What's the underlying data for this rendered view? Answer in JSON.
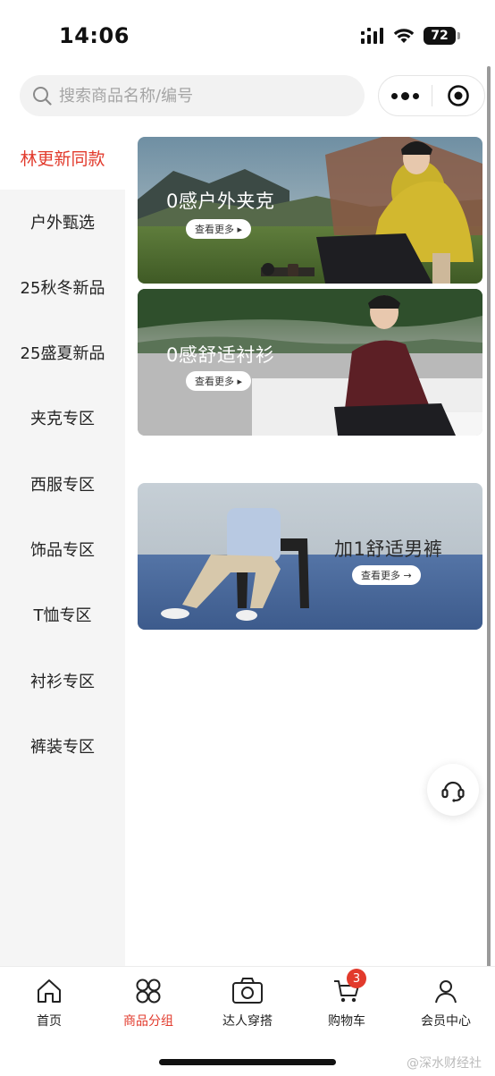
{
  "status_bar": {
    "time": "14:06",
    "battery": "72"
  },
  "search": {
    "placeholder": "搜索商品名称/编号",
    "value": ""
  },
  "sidebar": {
    "items": [
      {
        "label": "林更新同款",
        "active": true
      },
      {
        "label": "户外甄选"
      },
      {
        "label": "25秋冬新品"
      },
      {
        "label": "25盛夏新品"
      },
      {
        "label": "夹克专区"
      },
      {
        "label": "西服专区"
      },
      {
        "label": "饰品专区"
      },
      {
        "label": "T恤专区"
      },
      {
        "label": "衬衫专区"
      },
      {
        "label": "裤装专区"
      }
    ]
  },
  "banners": [
    {
      "title": "0感户外夹克",
      "button": "查看更多 ▸"
    },
    {
      "title": "0感舒适衬衫",
      "button": "查看更多 ▸"
    },
    {
      "title": "加1舒适男裤",
      "button": "查看更多 →"
    }
  ],
  "tabbar": {
    "items": [
      {
        "label": "首页",
        "icon": "home-icon"
      },
      {
        "label": "商品分组",
        "icon": "category-icon",
        "active": true
      },
      {
        "label": "达人穿搭",
        "icon": "camera-icon"
      },
      {
        "label": "购物车",
        "icon": "cart-icon",
        "badge": "3"
      },
      {
        "label": "会员中心",
        "icon": "user-icon"
      }
    ]
  },
  "watermark": "@深水财经社",
  "colors": {
    "accent": "#e23a2c",
    "sidebar_bg": "#f5f5f5"
  }
}
